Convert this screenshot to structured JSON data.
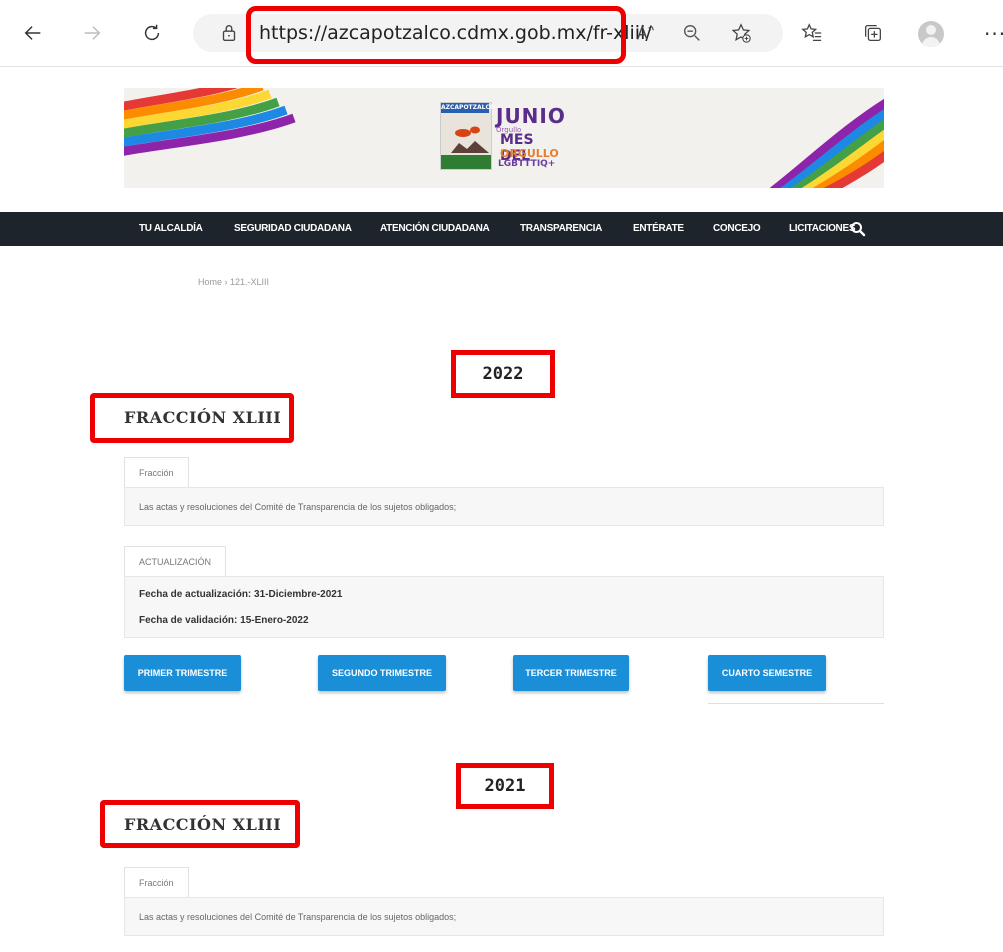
{
  "browser": {
    "url": "https://azcapotzalco.cdmx.gob.mx/fr-xliii/"
  },
  "banner": {
    "logo_badge": "AZCAPOTZALCO",
    "logo_title": "JUNIO",
    "logo_tagline": "Orgullo",
    "logo_line1": "MES DEL",
    "logo_line2": "ORGULLO",
    "logo_line3": "LGBTTTIQ+"
  },
  "nav": {
    "items": [
      {
        "label": "TU ALCALDÍA"
      },
      {
        "label": "SEGURIDAD CIUDADANA"
      },
      {
        "label": "ATENCIÓN CIUDADANA"
      },
      {
        "label": "TRANSPARENCIA"
      },
      {
        "label": "ENTÉRATE"
      },
      {
        "label": "CONCEJO"
      },
      {
        "label": "LICITACIONES"
      }
    ]
  },
  "breadcrumb": "Home  ›  121.-XLIII",
  "sections": [
    {
      "year": "2022",
      "title": "FRACCIÓN XLIII",
      "tab1": "Fracción",
      "description": "Las actas y resoluciones del Comité de Transparencia de los sujetos obligados;",
      "tab2": "ACTUALIZACIÓN",
      "update_date": "Fecha de actualización: 31-Diciembre-2021",
      "validation_date": "Fecha de validación: 15-Enero-2022",
      "buttons": [
        "PRIMER TRIMESTRE",
        "SEGUNDO TRIMESTRE",
        "TERCER TRIMESTRE",
        "CUARTO SEMESTRE"
      ]
    },
    {
      "year": "2021",
      "title": "FRACCIÓN XLIII",
      "tab1": "Fracción",
      "description": "Las actas y resoluciones del Comité de Transparencia de los sujetos obligados;"
    }
  ],
  "colors": {
    "nav_bg": "#1d242c",
    "button_bg": "#1a8fd8",
    "highlight": "#ee0000"
  }
}
